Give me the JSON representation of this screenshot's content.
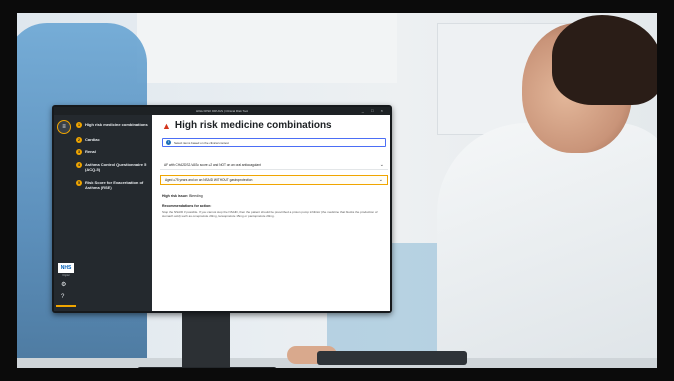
{
  "window": {
    "title": "HIGH RISK DRUGS | Clinical Risk Tool",
    "controls": [
      "_",
      "□",
      "×"
    ]
  },
  "sidebar": {
    "menu_icon": "menu-icon",
    "items": [
      {
        "num": "1",
        "label": "High risk medicine combinations"
      },
      {
        "num": "2",
        "label": "Cardiac"
      },
      {
        "num": "3",
        "label": "Renal"
      },
      {
        "num": "4",
        "label": "Asthma Control Questionnaire 5 (ACQ-5)"
      },
      {
        "num": "5",
        "label": "Risk Score for Exacerbation of Asthma (RSE)"
      }
    ],
    "logo": {
      "text": "NHS",
      "sub": "Digital"
    },
    "icons": [
      "gear-icon",
      "help-icon"
    ],
    "accent_color": "#f0a500"
  },
  "main": {
    "title": "High risk medicine combinations",
    "info_banner": "Select items based on the clinical context",
    "rows": [
      {
        "text": "AF with CHA2DS2-VASc score ≥2 and NOT on an oral anticoagulant",
        "active": false
      },
      {
        "text": "Aged ≥75 years and on an NSAID WITHOUT gastroprotection",
        "active": true
      }
    ],
    "risk_label": "High risk issue:",
    "risk_value": "Bleeding",
    "recommendations_title": "Recommendations for action:",
    "recommendations_text": "Stop the NSAID if possible. If you cannot stop the NSAID, then the patient should be prescribed a proton pump inhibitor (the medicine that blocks the production of stomach acid) such as omeprazole 20mg, lansoprazole 15mg or pantoprazole 20mg."
  }
}
